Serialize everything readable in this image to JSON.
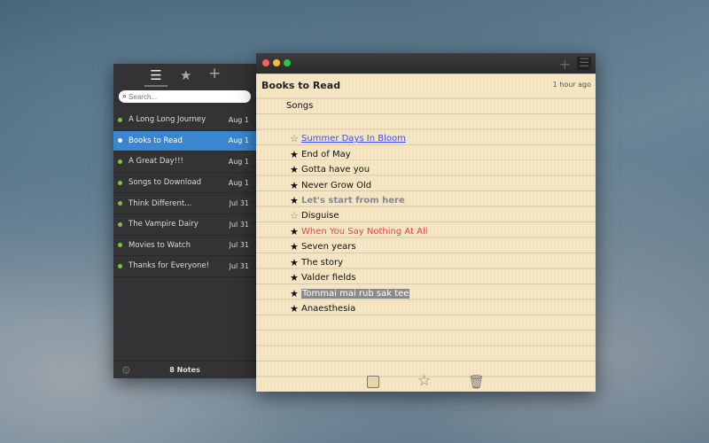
{
  "sidebar": {
    "search_placeholder": "Search...",
    "footer": "8 Notes",
    "notes": [
      {
        "title": "A Long Long Journey",
        "date": "Aug 1"
      },
      {
        "title": "Books to Read",
        "date": "Aug 1",
        "selected": true
      },
      {
        "title": "A Great Day!!!",
        "date": "Aug 1"
      },
      {
        "title": "Songs to Download",
        "date": "Aug 1"
      },
      {
        "title": "Think Different...",
        "date": "Jul 31"
      },
      {
        "title": "The Vampire Dairy",
        "date": "Jul 31"
      },
      {
        "title": "Movies to Watch",
        "date": "Jul 31"
      },
      {
        "title": "Thanks for Everyone!",
        "date": "Jul 31"
      }
    ]
  },
  "note": {
    "title": "Books to Read",
    "modified": "1 hour ago",
    "section": "Songs",
    "items": [
      {
        "star": "☆",
        "text": "Summer Days In Bloom",
        "style": "link"
      },
      {
        "star": "★",
        "text": "End of May",
        "style": ""
      },
      {
        "star": "★",
        "text": "Gotta have you",
        "style": ""
      },
      {
        "star": "★",
        "text": "Never Grow Old",
        "style": ""
      },
      {
        "star": "★",
        "text": "Let's start from here",
        "style": "grey"
      },
      {
        "star": "☆",
        "text": "Disguise",
        "style": ""
      },
      {
        "star": "★",
        "text": "When You Say Nothing At All",
        "style": "red"
      },
      {
        "star": "★",
        "text": "Seven years",
        "style": ""
      },
      {
        "star": "★",
        "text": "The story",
        "style": ""
      },
      {
        "star": "★",
        "text": "Valder fields",
        "style": ""
      },
      {
        "star": "★",
        "text": "Tommai mai rub sak tee",
        "style": "hl"
      },
      {
        "star": "★",
        "text": "Anaesthesia",
        "style": ""
      }
    ]
  },
  "colors": {
    "accent": "#3a86d0",
    "dot": "#7cc33a",
    "paper": "#f6e6c4"
  }
}
